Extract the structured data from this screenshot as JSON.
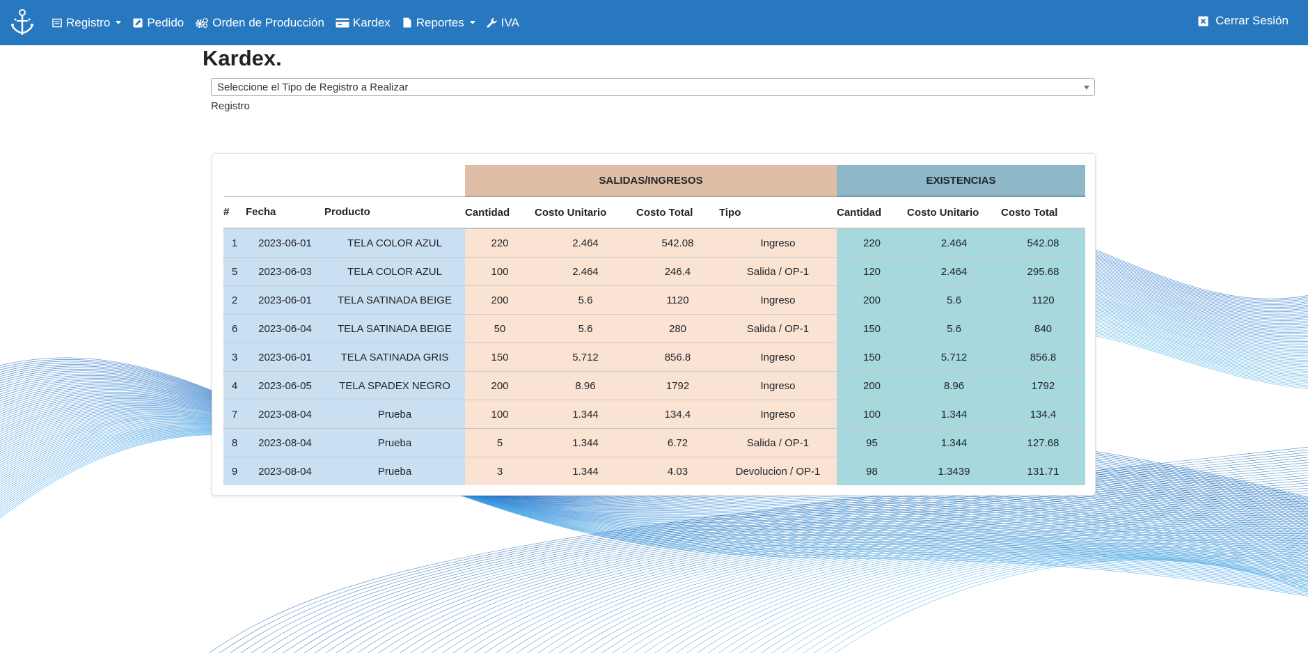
{
  "nav": {
    "items": [
      {
        "label": "Registro",
        "icon": "register-icon",
        "dropdown": true
      },
      {
        "label": "Pedido",
        "icon": "edit-icon",
        "dropdown": false
      },
      {
        "label": "Orden de Producción",
        "icon": "gears-icon",
        "dropdown": false
      },
      {
        "label": "Kardex",
        "icon": "card-icon",
        "dropdown": false
      },
      {
        "label": "Reportes",
        "icon": "file-icon",
        "dropdown": true
      },
      {
        "label": "IVA",
        "icon": "wrench-icon",
        "dropdown": false
      }
    ],
    "logout_label": "Cerrar Sesión"
  },
  "page": {
    "title": "Kardex.",
    "select_value": "Seleccione el Tipo de Registro a Realizar",
    "sub_label": "Registro"
  },
  "table": {
    "groups": {
      "salidas": "SALIDAS/INGRESOS",
      "existencias": "EXISTENCIAS"
    },
    "headers": [
      "#",
      "Fecha",
      "Producto",
      "Cantidad",
      "Costo Unitario",
      "Costo Total",
      "Tipo",
      "Cantidad",
      "Costo Unitario",
      "Costo Total"
    ],
    "rows": [
      [
        "1",
        "2023-06-01",
        "TELA COLOR AZUL",
        "220",
        "2.464",
        "542.08",
        "Ingreso",
        "220",
        "2.464",
        "542.08"
      ],
      [
        "5",
        "2023-06-03",
        "TELA COLOR AZUL",
        "100",
        "2.464",
        "246.4",
        "Salida / OP-1",
        "120",
        "2.464",
        "295.68"
      ],
      [
        "2",
        "2023-06-01",
        "TELA SATINADA BEIGE",
        "200",
        "5.6",
        "1120",
        "Ingreso",
        "200",
        "5.6",
        "1120"
      ],
      [
        "6",
        "2023-06-04",
        "TELA SATINADA BEIGE",
        "50",
        "5.6",
        "280",
        "Salida / OP-1",
        "150",
        "5.6",
        "840"
      ],
      [
        "3",
        "2023-06-01",
        "TELA SATINADA GRIS",
        "150",
        "5.712",
        "856.8",
        "Ingreso",
        "150",
        "5.712",
        "856.8"
      ],
      [
        "4",
        "2023-06-05",
        "TELA SPADEX NEGRO",
        "200",
        "8.96",
        "1792",
        "Ingreso",
        "200",
        "8.96",
        "1792"
      ],
      [
        "7",
        "2023-08-04",
        "Prueba",
        "100",
        "1.344",
        "134.4",
        "Ingreso",
        "100",
        "1.344",
        "134.4"
      ],
      [
        "8",
        "2023-08-04",
        "Prueba",
        "5",
        "1.344",
        "6.72",
        "Salida / OP-1",
        "95",
        "1.344",
        "127.68"
      ],
      [
        "9",
        "2023-08-04",
        "Prueba",
        "3",
        "1.344",
        "4.03",
        "Devolucion / OP-1",
        "98",
        "1.3439",
        "131.71"
      ]
    ]
  },
  "colors": {
    "navbar": "#2878bf",
    "group_salidas": "#dfbea8",
    "group_existencias": "#8eb8c8",
    "cell_blue": "#c9e0f3",
    "cell_peach": "#fbe3d4",
    "cell_teal": "#a6d8de"
  }
}
